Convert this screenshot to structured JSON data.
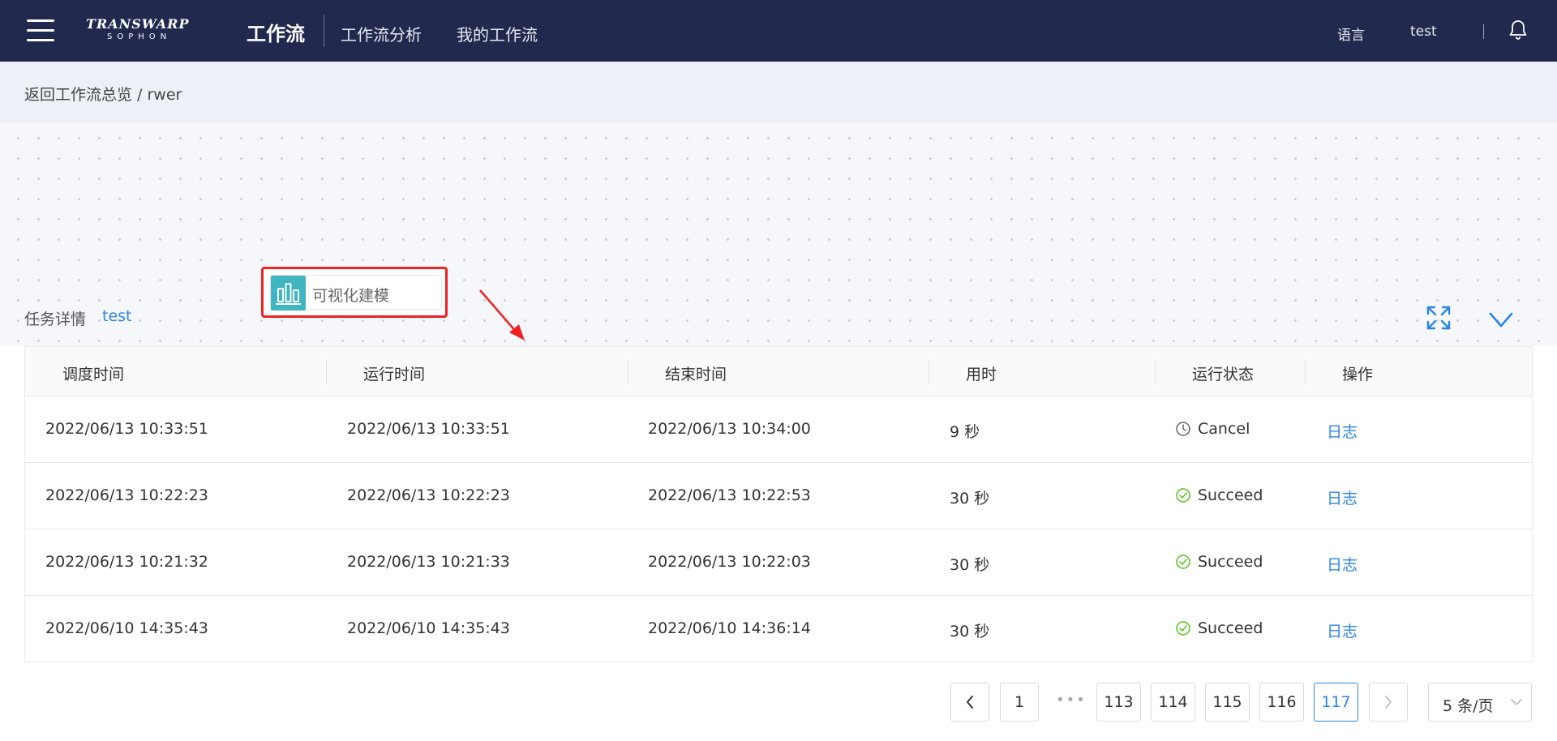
{
  "nav": {
    "logo_top": "TRANSWARP",
    "logo_bottom": "SOPHON",
    "active": "工作流",
    "items": [
      "工作流分析",
      "我的工作流"
    ],
    "language": "语言",
    "user": "test"
  },
  "breadcrumb": {
    "back": "返回工作流总览",
    "separator": " / ",
    "current": "rwer"
  },
  "canvas": {
    "node_label": "可视化建模",
    "node_icon": "bar-chart-icon",
    "highlight_color": "#ee2222"
  },
  "task": {
    "title": "任务详情",
    "user": "test"
  },
  "table": {
    "headers": [
      "调度时间",
      "运行时间",
      "结束时间",
      "用时",
      "运行状态",
      "操作"
    ],
    "rows": [
      {
        "scheduled": "2022/06/13 10:33:51",
        "run": "2022/06/13 10:33:51",
        "end": "2022/06/13 10:34:00",
        "duration": "9 秒",
        "status": "Cancel",
        "status_icon": "clock-icon",
        "action": "日志"
      },
      {
        "scheduled": "2022/06/13 10:22:23",
        "run": "2022/06/13 10:22:23",
        "end": "2022/06/13 10:22:53",
        "duration": "30 秒",
        "status": "Succeed",
        "status_icon": "check-circle-icon",
        "action": "日志"
      },
      {
        "scheduled": "2022/06/13 10:21:32",
        "run": "2022/06/13 10:21:33",
        "end": "2022/06/13 10:22:03",
        "duration": "30 秒",
        "status": "Succeed",
        "status_icon": "check-circle-icon",
        "action": "日志"
      },
      {
        "scheduled": "2022/06/10 14:35:43",
        "run": "2022/06/10 14:35:43",
        "end": "2022/06/10 14:36:14",
        "duration": "30 秒",
        "status": "Succeed",
        "status_icon": "check-circle-icon",
        "action": "日志"
      }
    ]
  },
  "pagination": {
    "first": "1",
    "ellipsis": "•••",
    "pages": [
      "113",
      "114",
      "115",
      "116",
      "117"
    ],
    "current": "117",
    "page_size": "5 条/页"
  },
  "colors": {
    "nav_bg": "#212a4e",
    "link": "#2a86e8",
    "success": "#52c41a"
  }
}
